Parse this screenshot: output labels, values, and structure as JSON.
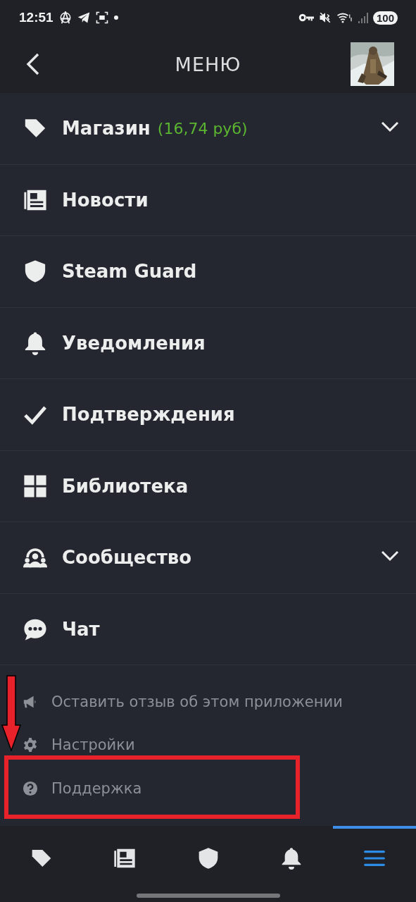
{
  "status_bar": {
    "time": "12:51",
    "battery": "100"
  },
  "header": {
    "title": "МЕНЮ"
  },
  "menu": [
    {
      "label": "Магазин",
      "balance": "(16,74 руб)",
      "expanded": false
    },
    {
      "label": "Новости"
    },
    {
      "label": "Steam Guard"
    },
    {
      "label": "Уведомления"
    },
    {
      "label": "Подтверждения"
    },
    {
      "label": "Библиотека"
    },
    {
      "label": "Сообщество",
      "expanded": false
    },
    {
      "label": "Чат"
    }
  ],
  "secondary_menu": [
    {
      "label": "Оставить отзыв об этом приложении"
    },
    {
      "label": "Настройки"
    },
    {
      "label": "Поддержка"
    }
  ],
  "bottom_nav": [
    {
      "selected": false
    },
    {
      "selected": false
    },
    {
      "selected": false
    },
    {
      "selected": false
    },
    {
      "selected": true
    }
  ]
}
